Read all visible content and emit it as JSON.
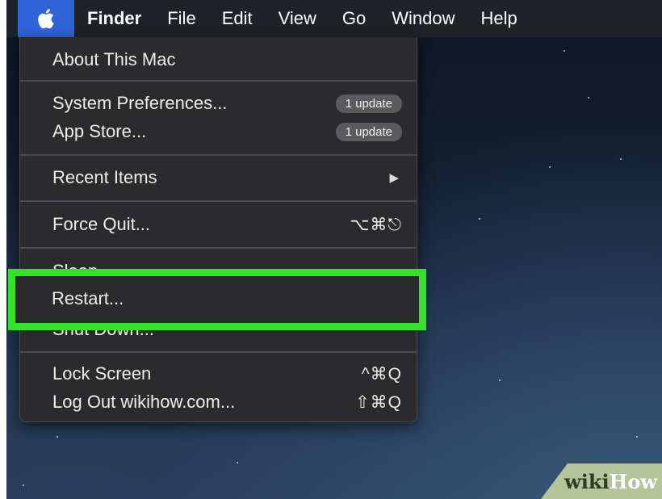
{
  "menubar": {
    "apple_icon": "apple-logo",
    "items": [
      "Finder",
      "File",
      "Edit",
      "View",
      "Go",
      "Window",
      "Help"
    ]
  },
  "apple_menu": {
    "about": "About This Mac",
    "system_prefs": {
      "label": "System Preferences...",
      "badge": "1 update"
    },
    "app_store": {
      "label": "App Store...",
      "badge": "1 update"
    },
    "recent_items": {
      "label": "Recent Items",
      "arrow": "▶"
    },
    "force_quit": {
      "label": "Force Quit...",
      "shortcut": "⌥⌘⎋"
    },
    "sleep": {
      "label": "Sleep"
    },
    "restart": {
      "label": "Restart..."
    },
    "shut_down": {
      "label": "Shut Down..."
    },
    "lock_screen": {
      "label": "Lock Screen",
      "shortcut": "^⌘Q"
    },
    "log_out": {
      "label": "Log Out wikihow.com...",
      "shortcut": "⇧⌘Q"
    }
  },
  "highlight_color": "#35e02a",
  "watermark": {
    "part1": "wiki",
    "part2": "How"
  }
}
